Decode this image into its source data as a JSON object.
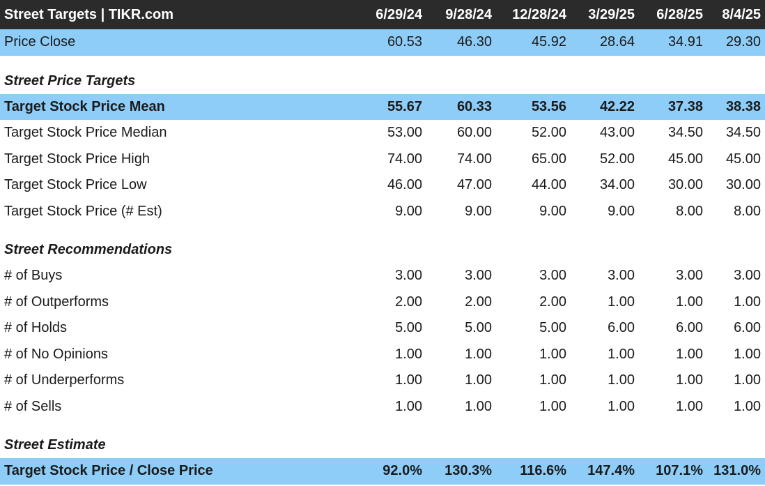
{
  "title": "Street Targets | TIKR.com",
  "columns": [
    "6/29/24",
    "9/28/24",
    "12/28/24",
    "3/29/25",
    "6/28/25",
    "8/4/25"
  ],
  "price_close": {
    "label": "Price Close",
    "values": [
      "60.53",
      "46.30",
      "45.92",
      "28.64",
      "34.91",
      "29.30"
    ]
  },
  "sections": {
    "targets": {
      "title": "Street Price Targets",
      "rows": [
        {
          "label": "Target Stock Price Mean",
          "values": [
            "55.67",
            "60.33",
            "53.56",
            "42.22",
            "37.38",
            "38.38"
          ]
        },
        {
          "label": "Target Stock Price Median",
          "values": [
            "53.00",
            "60.00",
            "52.00",
            "43.00",
            "34.50",
            "34.50"
          ]
        },
        {
          "label": "Target Stock Price High",
          "values": [
            "74.00",
            "74.00",
            "65.00",
            "52.00",
            "45.00",
            "45.00"
          ]
        },
        {
          "label": "Target Stock Price Low",
          "values": [
            "46.00",
            "47.00",
            "44.00",
            "34.00",
            "30.00",
            "30.00"
          ]
        },
        {
          "label": "Target Stock Price (# Est)",
          "values": [
            "9.00",
            "9.00",
            "9.00",
            "9.00",
            "8.00",
            "8.00"
          ]
        }
      ]
    },
    "recommendations": {
      "title": "Street Recommendations",
      "rows": [
        {
          "label": "# of Buys",
          "values": [
            "3.00",
            "3.00",
            "3.00",
            "3.00",
            "3.00",
            "3.00"
          ]
        },
        {
          "label": "# of Outperforms",
          "values": [
            "2.00",
            "2.00",
            "2.00",
            "1.00",
            "1.00",
            "1.00"
          ]
        },
        {
          "label": "# of Holds",
          "values": [
            "5.00",
            "5.00",
            "5.00",
            "6.00",
            "6.00",
            "6.00"
          ]
        },
        {
          "label": "# of No Opinions",
          "values": [
            "1.00",
            "1.00",
            "1.00",
            "1.00",
            "1.00",
            "1.00"
          ]
        },
        {
          "label": "# of Underperforms",
          "values": [
            "1.00",
            "1.00",
            "1.00",
            "1.00",
            "1.00",
            "1.00"
          ]
        },
        {
          "label": "# of Sells",
          "values": [
            "1.00",
            "1.00",
            "1.00",
            "1.00",
            "1.00",
            "1.00"
          ]
        }
      ]
    },
    "estimate": {
      "title": "Street Estimate",
      "rows": [
        {
          "label": "Target Stock Price / Close Price",
          "values": [
            "92.0%",
            "130.3%",
            "116.6%",
            "147.4%",
            "107.1%",
            "131.0%"
          ]
        }
      ]
    }
  },
  "colors": {
    "header_bg": "#2b2b2b",
    "highlight_bg": "#8ecdf8"
  }
}
